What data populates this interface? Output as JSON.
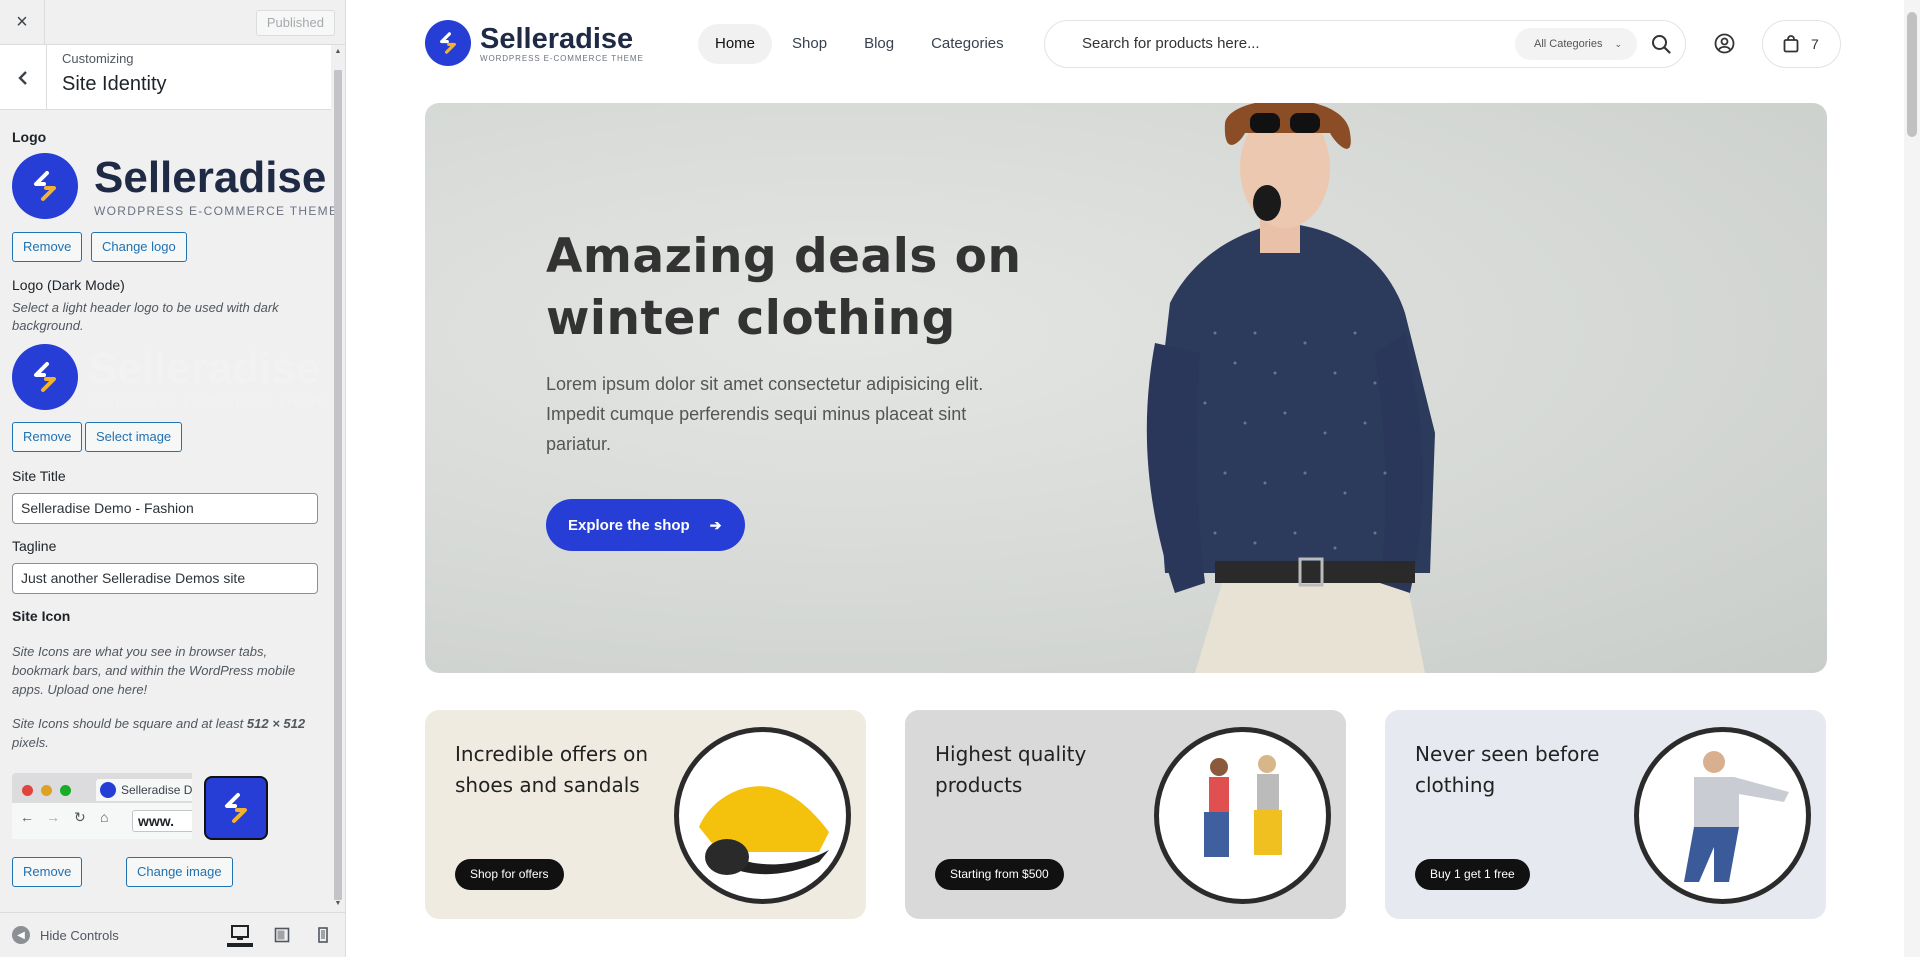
{
  "customizer": {
    "close_label": "×",
    "published_label": "Published",
    "section": {
      "customizing": "Customizing",
      "title": "Site Identity"
    },
    "logo": {
      "title": "Logo",
      "brand_name": "Selleradise",
      "brand_sub": "WORDPRESS E-COMMERCE THEME",
      "remove_label": "Remove",
      "change_label": "Change logo"
    },
    "logo_dark": {
      "title": "Logo (Dark Mode)",
      "description": "Select a light header logo to be used with dark background.",
      "brand_name": "Selleradise",
      "brand_sub": "WORDPRESS ECOMMERCE THEME",
      "remove_label": "Remove",
      "select_label": "Select image"
    },
    "site_title": {
      "label": "Site Title",
      "value": "Selleradise Demo - Fashion"
    },
    "tagline": {
      "label": "Tagline",
      "value": "Just another Selleradise Demos site"
    },
    "site_icon": {
      "label": "Site Icon",
      "desc1": "Site Icons are what you see in browser tabs, bookmark bars, and within the WordPress mobile apps. Upload one here!",
      "desc2_prefix": "Site Icons should be square and at least ",
      "desc2_size": "512 × 512",
      "desc2_suffix": " pixels.",
      "tab_title": "Selleradise D",
      "url_text": "www.",
      "remove_label": "Remove",
      "change_label": "Change image"
    },
    "footer": {
      "hide_controls": "Hide Controls",
      "devices": [
        "desktop",
        "tablet",
        "mobile"
      ],
      "active_device": "desktop"
    }
  },
  "site": {
    "logo_name": "Selleradise",
    "logo_sub": "WORDPRESS E-COMMERCE THEME",
    "nav": [
      {
        "label": "Home",
        "active": true
      },
      {
        "label": "Shop",
        "active": false
      },
      {
        "label": "Blog",
        "active": false
      },
      {
        "label": "Categories",
        "active": false
      }
    ],
    "search": {
      "placeholder": "Search for products here...",
      "category": "All Categories"
    },
    "cart_count": "7",
    "hero": {
      "title": "Amazing deals on winter clothing",
      "description": "Lorem ipsum dolor sit amet consectetur adipisicing elit. Impedit cumque perferendis sequi minus placeat sint pariatur.",
      "button": "Explore the shop"
    },
    "promos": [
      {
        "title": "Incredible offers on shoes and sandals",
        "button": "Shop for offers",
        "bg": "#efebe0"
      },
      {
        "title": "Highest quality products",
        "button": "Starting from $500",
        "bg": "#d9d9d9"
      },
      {
        "title": "Never seen before clothing",
        "button": "Buy 1 get 1 free",
        "bg": "#e6e9f0"
      }
    ]
  },
  "colors": {
    "brand_blue": "#263ed6",
    "wp_blue": "#2271b1"
  }
}
